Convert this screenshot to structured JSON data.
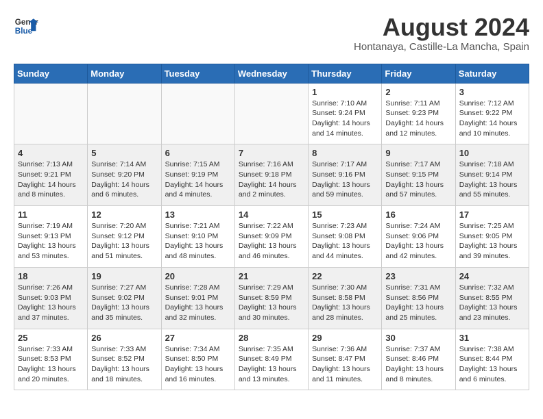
{
  "header": {
    "logo_general": "General",
    "logo_blue": "Blue",
    "month_year": "August 2024",
    "location": "Hontanaya, Castille-La Mancha, Spain"
  },
  "weekdays": [
    "Sunday",
    "Monday",
    "Tuesday",
    "Wednesday",
    "Thursday",
    "Friday",
    "Saturday"
  ],
  "weeks": [
    [
      {
        "day": "",
        "info": ""
      },
      {
        "day": "",
        "info": ""
      },
      {
        "day": "",
        "info": ""
      },
      {
        "day": "",
        "info": ""
      },
      {
        "day": "1",
        "info": "Sunrise: 7:10 AM\nSunset: 9:24 PM\nDaylight: 14 hours\nand 14 minutes."
      },
      {
        "day": "2",
        "info": "Sunrise: 7:11 AM\nSunset: 9:23 PM\nDaylight: 14 hours\nand 12 minutes."
      },
      {
        "day": "3",
        "info": "Sunrise: 7:12 AM\nSunset: 9:22 PM\nDaylight: 14 hours\nand 10 minutes."
      }
    ],
    [
      {
        "day": "4",
        "info": "Sunrise: 7:13 AM\nSunset: 9:21 PM\nDaylight: 14 hours\nand 8 minutes."
      },
      {
        "day": "5",
        "info": "Sunrise: 7:14 AM\nSunset: 9:20 PM\nDaylight: 14 hours\nand 6 minutes."
      },
      {
        "day": "6",
        "info": "Sunrise: 7:15 AM\nSunset: 9:19 PM\nDaylight: 14 hours\nand 4 minutes."
      },
      {
        "day": "7",
        "info": "Sunrise: 7:16 AM\nSunset: 9:18 PM\nDaylight: 14 hours\nand 2 minutes."
      },
      {
        "day": "8",
        "info": "Sunrise: 7:17 AM\nSunset: 9:16 PM\nDaylight: 13 hours\nand 59 minutes."
      },
      {
        "day": "9",
        "info": "Sunrise: 7:17 AM\nSunset: 9:15 PM\nDaylight: 13 hours\nand 57 minutes."
      },
      {
        "day": "10",
        "info": "Sunrise: 7:18 AM\nSunset: 9:14 PM\nDaylight: 13 hours\nand 55 minutes."
      }
    ],
    [
      {
        "day": "11",
        "info": "Sunrise: 7:19 AM\nSunset: 9:13 PM\nDaylight: 13 hours\nand 53 minutes."
      },
      {
        "day": "12",
        "info": "Sunrise: 7:20 AM\nSunset: 9:12 PM\nDaylight: 13 hours\nand 51 minutes."
      },
      {
        "day": "13",
        "info": "Sunrise: 7:21 AM\nSunset: 9:10 PM\nDaylight: 13 hours\nand 48 minutes."
      },
      {
        "day": "14",
        "info": "Sunrise: 7:22 AM\nSunset: 9:09 PM\nDaylight: 13 hours\nand 46 minutes."
      },
      {
        "day": "15",
        "info": "Sunrise: 7:23 AM\nSunset: 9:08 PM\nDaylight: 13 hours\nand 44 minutes."
      },
      {
        "day": "16",
        "info": "Sunrise: 7:24 AM\nSunset: 9:06 PM\nDaylight: 13 hours\nand 42 minutes."
      },
      {
        "day": "17",
        "info": "Sunrise: 7:25 AM\nSunset: 9:05 PM\nDaylight: 13 hours\nand 39 minutes."
      }
    ],
    [
      {
        "day": "18",
        "info": "Sunrise: 7:26 AM\nSunset: 9:03 PM\nDaylight: 13 hours\nand 37 minutes."
      },
      {
        "day": "19",
        "info": "Sunrise: 7:27 AM\nSunset: 9:02 PM\nDaylight: 13 hours\nand 35 minutes."
      },
      {
        "day": "20",
        "info": "Sunrise: 7:28 AM\nSunset: 9:01 PM\nDaylight: 13 hours\nand 32 minutes."
      },
      {
        "day": "21",
        "info": "Sunrise: 7:29 AM\nSunset: 8:59 PM\nDaylight: 13 hours\nand 30 minutes."
      },
      {
        "day": "22",
        "info": "Sunrise: 7:30 AM\nSunset: 8:58 PM\nDaylight: 13 hours\nand 28 minutes."
      },
      {
        "day": "23",
        "info": "Sunrise: 7:31 AM\nSunset: 8:56 PM\nDaylight: 13 hours\nand 25 minutes."
      },
      {
        "day": "24",
        "info": "Sunrise: 7:32 AM\nSunset: 8:55 PM\nDaylight: 13 hours\nand 23 minutes."
      }
    ],
    [
      {
        "day": "25",
        "info": "Sunrise: 7:33 AM\nSunset: 8:53 PM\nDaylight: 13 hours\nand 20 minutes."
      },
      {
        "day": "26",
        "info": "Sunrise: 7:33 AM\nSunset: 8:52 PM\nDaylight: 13 hours\nand 18 minutes."
      },
      {
        "day": "27",
        "info": "Sunrise: 7:34 AM\nSunset: 8:50 PM\nDaylight: 13 hours\nand 16 minutes."
      },
      {
        "day": "28",
        "info": "Sunrise: 7:35 AM\nSunset: 8:49 PM\nDaylight: 13 hours\nand 13 minutes."
      },
      {
        "day": "29",
        "info": "Sunrise: 7:36 AM\nSunset: 8:47 PM\nDaylight: 13 hours\nand 11 minutes."
      },
      {
        "day": "30",
        "info": "Sunrise: 7:37 AM\nSunset: 8:46 PM\nDaylight: 13 hours\nand 8 minutes."
      },
      {
        "day": "31",
        "info": "Sunrise: 7:38 AM\nSunset: 8:44 PM\nDaylight: 13 hours\nand 6 minutes."
      }
    ]
  ]
}
